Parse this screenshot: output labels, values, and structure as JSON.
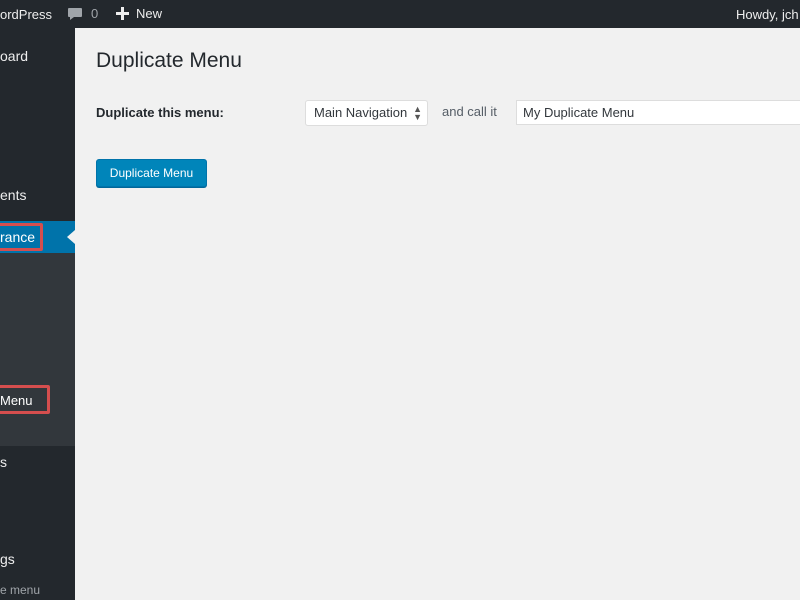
{
  "adminbar": {
    "site_name": "ordPress",
    "comment_count": "0",
    "new_label": "New",
    "howdy": "Howdy, jch"
  },
  "sidebar": {
    "items": [
      {
        "label": "oard"
      },
      {
        "label": "ents"
      },
      {
        "label": "rance"
      },
      {
        "label": "Menu"
      },
      {
        "label": "s"
      },
      {
        "label": "gs"
      }
    ],
    "collapse_label": "e menu"
  },
  "main": {
    "title": "Duplicate Menu",
    "form_label": "Duplicate this menu:",
    "select_value": "Main Navigation",
    "and_call_label": "and call it",
    "name_value": "My Duplicate Menu",
    "button_label": "Duplicate Menu"
  },
  "colors": {
    "adminbar_bg": "#23282d",
    "sidebar_active": "#0073aa",
    "button_bg": "#0085ba",
    "highlight": "#d54e4e"
  }
}
